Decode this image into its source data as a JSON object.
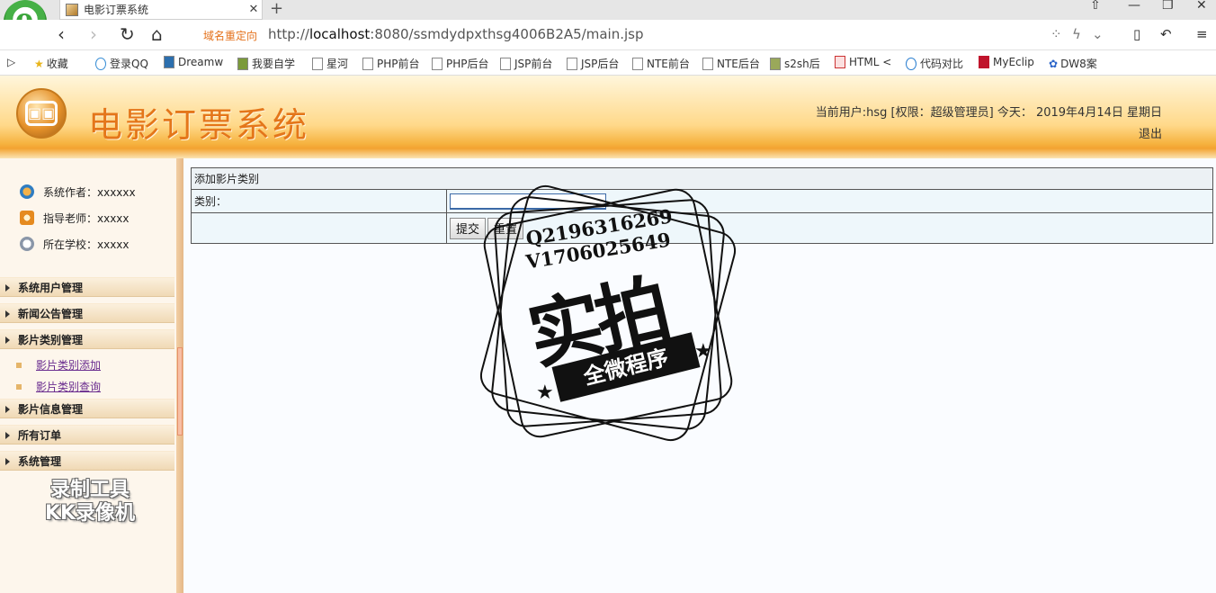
{
  "browser": {
    "tab_title": "电影订票系统",
    "tab_close": "✕",
    "new_tab": "+",
    "redirect_label": "域名重定向",
    "url_prefix": "http://",
    "url_host": "localhost",
    "url_rest": ":8080/ssmdydpxthsg4006B2A5/main.jsp",
    "bookmarks": [
      "收藏",
      "登录QQ",
      "Dreamw",
      "我要自学",
      "星河",
      "PHP前台",
      "PHP后台",
      "JSP前台",
      "JSP后台",
      "NTE前台",
      "NTE后台",
      "s2sh后",
      "HTML <",
      "代码对比",
      "MyEclip",
      "DW8案"
    ]
  },
  "header": {
    "title": "电影订票系统",
    "user_info": "当前用户:hsg [权限：超级管理员] 今天： 2019年4月14日 星期日",
    "logout": "退出"
  },
  "sidebar": {
    "info": [
      {
        "label": "系统作者：xxxxxx"
      },
      {
        "label": "指导老师：xxxxx"
      },
      {
        "label": "所在学校：xxxxx"
      }
    ],
    "menus": [
      {
        "label": "系统用户管理"
      },
      {
        "label": "新闻公告管理"
      },
      {
        "label": "影片类别管理",
        "children": [
          "影片类别添加",
          "影片类别查询"
        ]
      },
      {
        "label": "影片信息管理"
      },
      {
        "label": "所有订单"
      },
      {
        "label": "系统管理"
      }
    ],
    "recorder_watermark": [
      "录制工具",
      "KK录像机"
    ]
  },
  "form": {
    "heading": "添加影片类别",
    "category_label": "类别：",
    "category_value": "",
    "submit_label": "提交",
    "reset_label": "重置"
  },
  "stamp": {
    "line1": "Q2196316269",
    "line2": "V1706025649",
    "big": "实拍",
    "ribbon": "全微程序"
  }
}
